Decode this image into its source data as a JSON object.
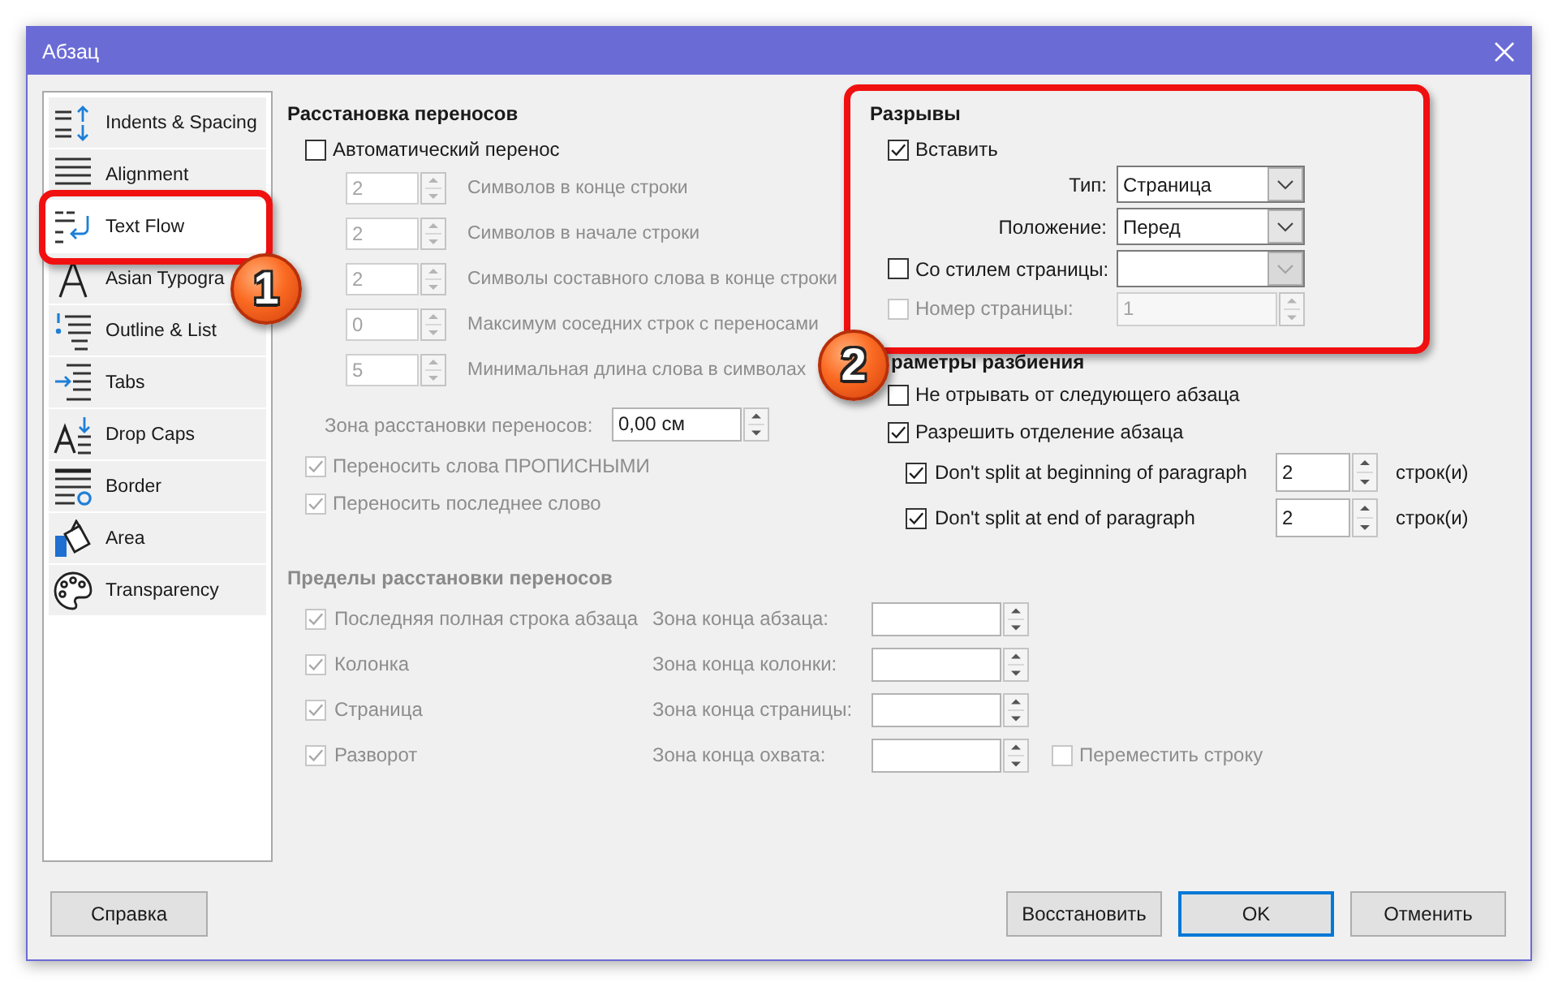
{
  "window": {
    "title": "Абзац"
  },
  "sidebar": {
    "items": [
      {
        "label": "Indents & Spacing",
        "kind": "indents",
        "selected": false
      },
      {
        "label": "Alignment",
        "kind": "alignment",
        "selected": false
      },
      {
        "label": "Text Flow",
        "kind": "textflow",
        "selected": true
      },
      {
        "label": "Asian Typogra",
        "kind": "asian",
        "selected": false
      },
      {
        "label": "Outline & List",
        "kind": "outline",
        "selected": false
      },
      {
        "label": "Tabs",
        "kind": "tabs",
        "selected": false
      },
      {
        "label": "Drop Caps",
        "kind": "dropcaps",
        "selected": false
      },
      {
        "label": "Border",
        "kind": "border",
        "selected": false
      },
      {
        "label": "Area",
        "kind": "area",
        "selected": false
      },
      {
        "label": "Transparency",
        "kind": "transparency",
        "selected": false
      }
    ]
  },
  "hyphenation": {
    "title": "Расстановка переносов",
    "auto": {
      "label": "Автоматический перенос",
      "checked": false
    },
    "fields": [
      {
        "value": "2",
        "label": "Символов в конце строки",
        "disabled": true
      },
      {
        "value": "2",
        "label": "Символов в начале строки",
        "disabled": true
      },
      {
        "value": "2",
        "label": "Символы составного слова в конце строки",
        "disabled": true
      },
      {
        "value": "0",
        "label": "Максимум соседних строк с переносами",
        "disabled": true
      },
      {
        "value": "5",
        "label": "Минимальная длина слова в символах",
        "disabled": true
      }
    ],
    "zone": {
      "label": "Зона расстановки переносов:",
      "value": "0,00 см",
      "disabled": true
    },
    "options": [
      {
        "label": "Переносить слова ПРОПИСНЫМИ",
        "checked": true,
        "disabled": true
      },
      {
        "label": "Переносить последнее слово",
        "checked": true,
        "disabled": true
      }
    ]
  },
  "breaks": {
    "title": "Разрывы",
    "insert": {
      "label": "Вставить",
      "checked": true
    },
    "type": {
      "label": "Тип:",
      "value": "Страница"
    },
    "position": {
      "label": "Положение:",
      "value": "Перед"
    },
    "page_style": {
      "label": "Со стилем страницы:",
      "checked": false
    },
    "page_number": {
      "label": "Номер страницы:",
      "value": "1",
      "checked": false,
      "disabled": true
    }
  },
  "split": {
    "title": "раметры разбиения",
    "options": [
      {
        "label": "Не отрывать от следующего абзаца",
        "checked": false
      },
      {
        "label": "Разрешить отделение абзаца",
        "checked": true
      }
    ],
    "lines": [
      {
        "label": "Don't split at beginning of paragraph",
        "checked": true,
        "value": "2",
        "unit": "строк(и)"
      },
      {
        "label": "Don't split at end of paragraph",
        "checked": true,
        "value": "2",
        "unit": "строк(и)"
      }
    ]
  },
  "limits": {
    "title": "Пределы расстановки переносов",
    "disabled": true,
    "rows": [
      {
        "label": "Последняя полная строка абзаца",
        "checked": true,
        "zone_label": "Зона конца абзаца:"
      },
      {
        "label": "Колонка",
        "checked": true,
        "zone_label": "Зона конца колонки:"
      },
      {
        "label": "Страница",
        "checked": true,
        "zone_label": "Зона конца страницы:"
      },
      {
        "label": "Разворот",
        "checked": true,
        "zone_label": "Зона конца охвата:"
      }
    ],
    "move_line": {
      "label": "Переместить строку",
      "checked": false
    }
  },
  "buttons": {
    "help": {
      "label": "Справка"
    },
    "actions": [
      {
        "label": "Восстановить",
        "focused": false
      },
      {
        "label": "OK",
        "focused": true
      },
      {
        "label": "Отменить",
        "focused": false
      }
    ]
  },
  "annotations": [
    {
      "number": "1"
    },
    {
      "number": "2"
    }
  ]
}
